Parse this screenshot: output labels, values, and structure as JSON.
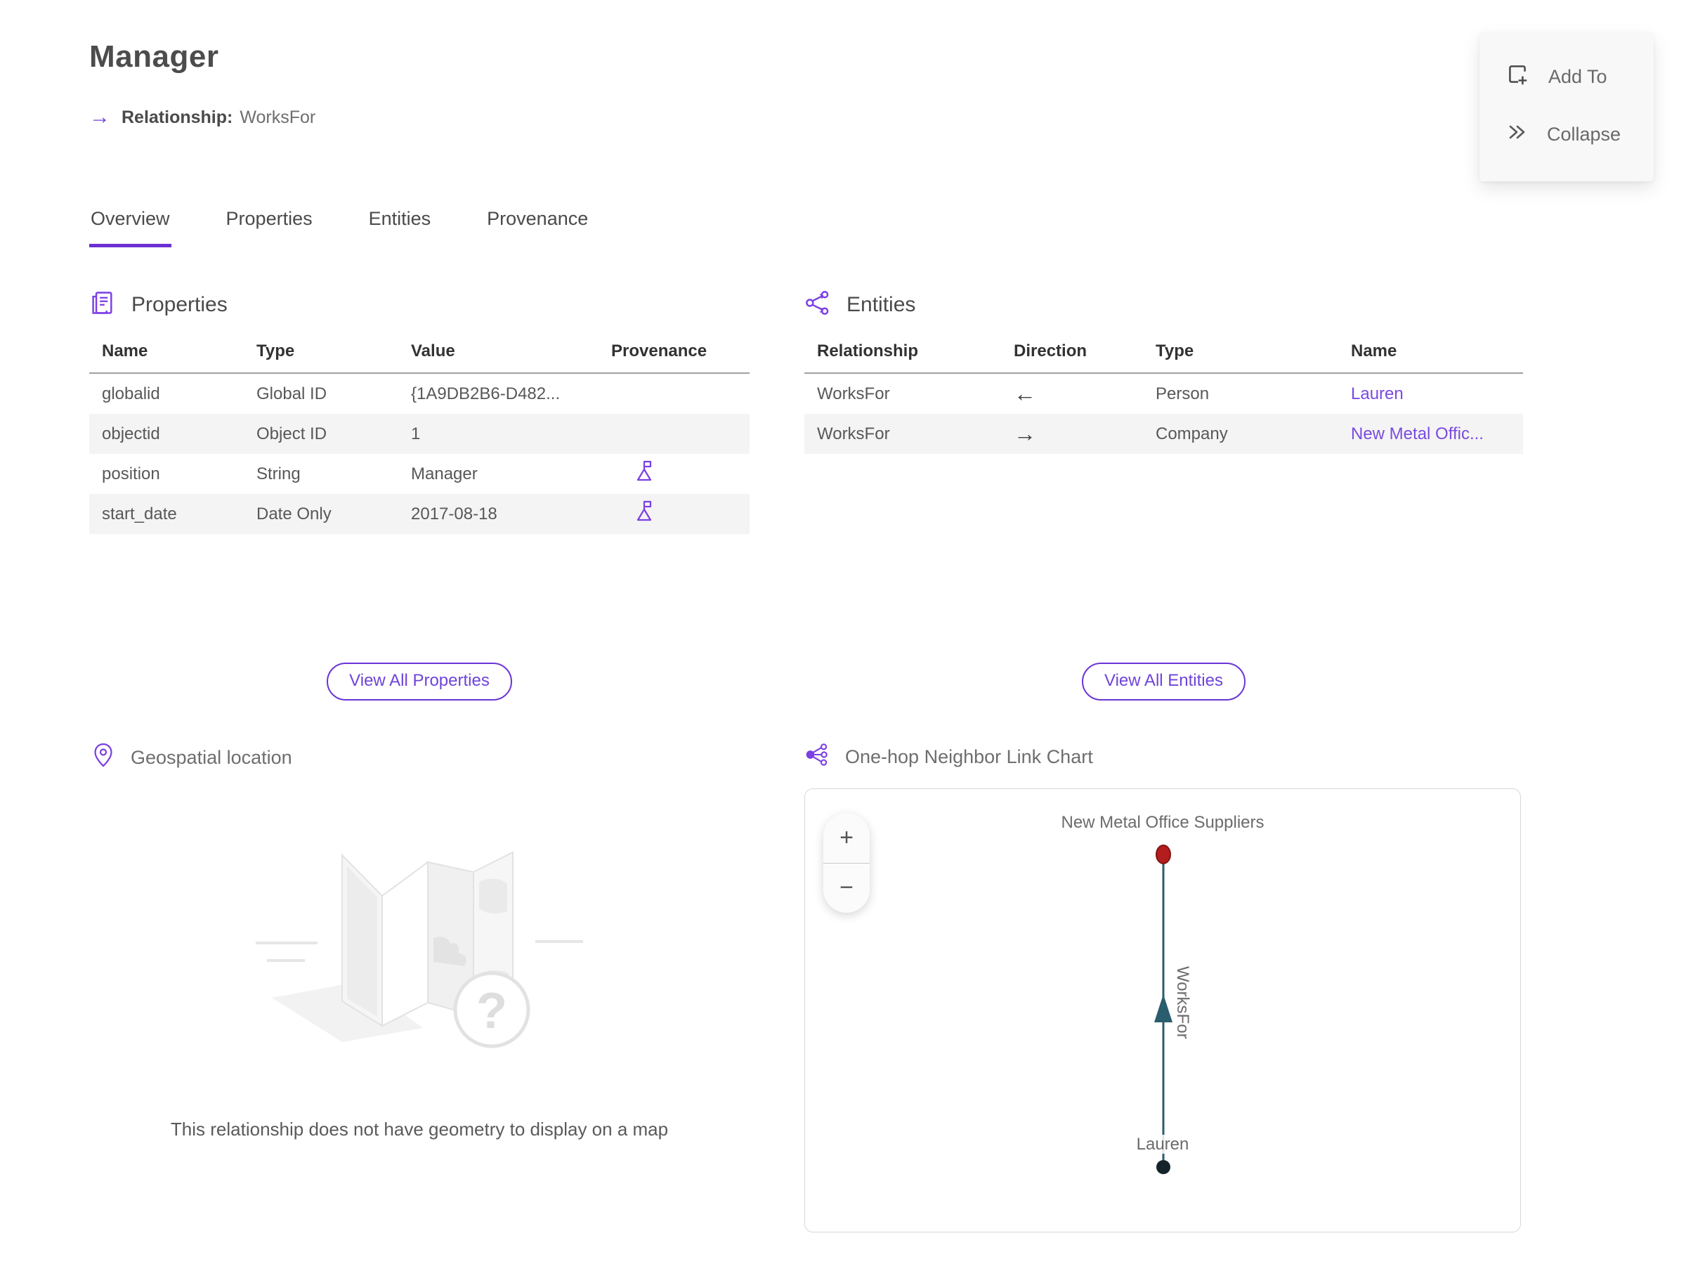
{
  "header": {
    "title": "Manager",
    "relationship_label": "Relationship:",
    "relationship_value": "WorksFor"
  },
  "actions": {
    "add_to": {
      "label": "Add To",
      "icon": "add-to-square"
    },
    "collapse": {
      "label": "Collapse",
      "icon": "double-chevron-right"
    }
  },
  "tabs": [
    {
      "label": "Overview",
      "active": true
    },
    {
      "label": "Properties",
      "active": false
    },
    {
      "label": "Entities",
      "active": false
    },
    {
      "label": "Provenance",
      "active": false
    }
  ],
  "properties_section": {
    "title": "Properties",
    "columns": [
      "Name",
      "Type",
      "Value",
      "Provenance"
    ],
    "rows": [
      {
        "name": "globalid",
        "type": "Global ID",
        "value": "{1A9DB2B6-D482...",
        "has_provenance": false
      },
      {
        "name": "objectid",
        "type": "Object ID",
        "value": "1",
        "has_provenance": false
      },
      {
        "name": "position",
        "type": "String",
        "value": "Manager",
        "has_provenance": true
      },
      {
        "name": "start_date",
        "type": "Date Only",
        "value": "2017-08-18",
        "has_provenance": true
      }
    ],
    "view_all_label": "View All Properties"
  },
  "entities_section": {
    "title": "Entities",
    "columns": [
      "Relationship",
      "Direction",
      "Type",
      "Name"
    ],
    "rows": [
      {
        "relationship": "WorksFor",
        "direction": "←",
        "type": "Person",
        "name": "Lauren"
      },
      {
        "relationship": "WorksFor",
        "direction": "→",
        "type": "Company",
        "name": "New Metal Offic..."
      }
    ],
    "view_all_label": "View All Entities"
  },
  "geospatial_section": {
    "title": "Geospatial location",
    "empty_message": "This relationship does not have geometry to display on a map"
  },
  "link_chart_section": {
    "title": "One-hop Neighbor Link Chart",
    "zoom_in": "+",
    "zoom_out": "−",
    "top_node": {
      "label": "New Metal Office Suppliers",
      "color": "#b41d1d",
      "stroke": "#801414"
    },
    "bottom_node": {
      "label": "Lauren",
      "color": "#15232b"
    },
    "edge": {
      "label": "WorksFor",
      "color": "#2a5d6d"
    }
  },
  "colors": {
    "accent_purple": "#713ddb",
    "tab_underline": "#6c30d2",
    "link_purple": "#7a4be0",
    "row_alt_background": "#f4f4f4"
  }
}
